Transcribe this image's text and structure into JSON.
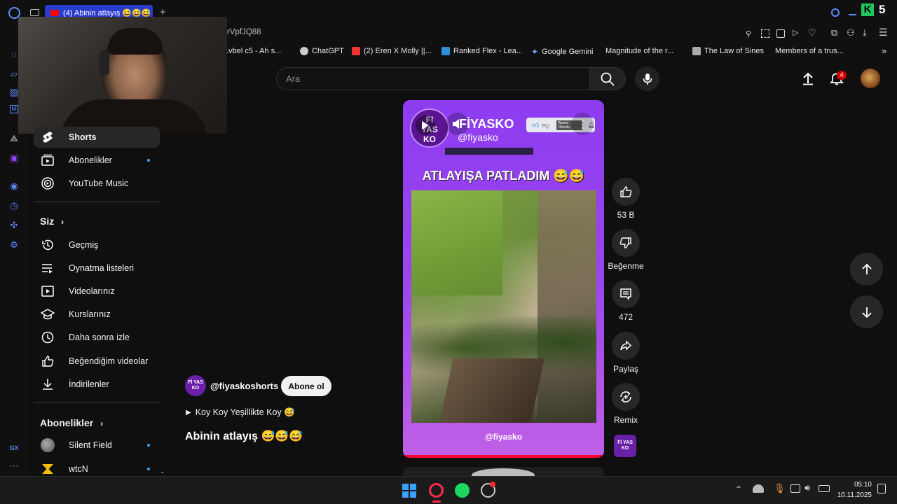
{
  "browser": {
    "tab_title": "(4) Abinin atlayış 😅😅😅",
    "url_fragment": "rVpfJQ88",
    "bookmarks": [
      {
        "label": "Lvbel c5 - Ah s...",
        "color": "#e33"
      },
      {
        "label": "ChatGPT",
        "color": "#ccc"
      },
      {
        "label": "(2) Eren X Molly ||...",
        "color": "#e33"
      },
      {
        "label": "Ranked Flex - Lea...",
        "color": "#2d8fd8"
      },
      {
        "label": "Google Gemini",
        "color": "#7aa7ff"
      },
      {
        "label": "Magnitude of the r...",
        "color": "#3a63c9"
      },
      {
        "label": "The Law of Sines",
        "color": "#aaa"
      },
      {
        "label": "Members of a trus...",
        "color": "#3a63c9"
      }
    ],
    "opera_gx_label": "GX",
    "extension_badge": "5"
  },
  "youtube": {
    "search_placeholder": "Ara",
    "notification_count": "4",
    "sidebar": {
      "top_items": [
        {
          "label": "Shorts",
          "icon": "shorts-icon"
        },
        {
          "label": "Abonelikler",
          "icon": "subscriptions-icon",
          "dot": true
        },
        {
          "label": "YouTube Music",
          "icon": "youtube-music-icon"
        }
      ],
      "you_header": "Siz",
      "you_items": [
        {
          "label": "Geçmiş",
          "icon": "history-icon"
        },
        {
          "label": "Oynatma listeleri",
          "icon": "playlists-icon"
        },
        {
          "label": "Videolarınız",
          "icon": "your-videos-icon"
        },
        {
          "label": "Kurslarınız",
          "icon": "courses-icon"
        },
        {
          "label": "Daha sonra izle",
          "icon": "watch-later-icon"
        },
        {
          "label": "Beğendiğim videolar",
          "icon": "liked-videos-icon"
        },
        {
          "label": "İndirilenler",
          "icon": "downloads-icon"
        }
      ],
      "subs_header": "Abonelikler",
      "subs_items": [
        {
          "label": "Silent Field",
          "dot": true
        },
        {
          "label": "wtcN",
          "dot": true
        }
      ]
    },
    "short": {
      "overlay_channel": "FİYASKO",
      "overlay_handle": "@fiyasko",
      "overlay_subscribe": "Abone Olundu",
      "overlay_caption": "ATLAYIŞA PATLADIM 😅😅",
      "watermark": "@fiyasko",
      "channel_handle": "@fiyaskoshorts",
      "subscribe_label": "Abone ol",
      "music": "Koy Koy Yeşillikte Koy 😅",
      "title": "Abinin atlayış 😅😅😅",
      "avatar_text": "Fİ YAS KO"
    },
    "actions": {
      "likes": "53 B",
      "dislike": "Beğenme",
      "comments": "472",
      "share": "Paylaş",
      "remix": "Remix"
    }
  },
  "taskbar": {
    "time": "05:10",
    "date": "10.11.2025"
  }
}
